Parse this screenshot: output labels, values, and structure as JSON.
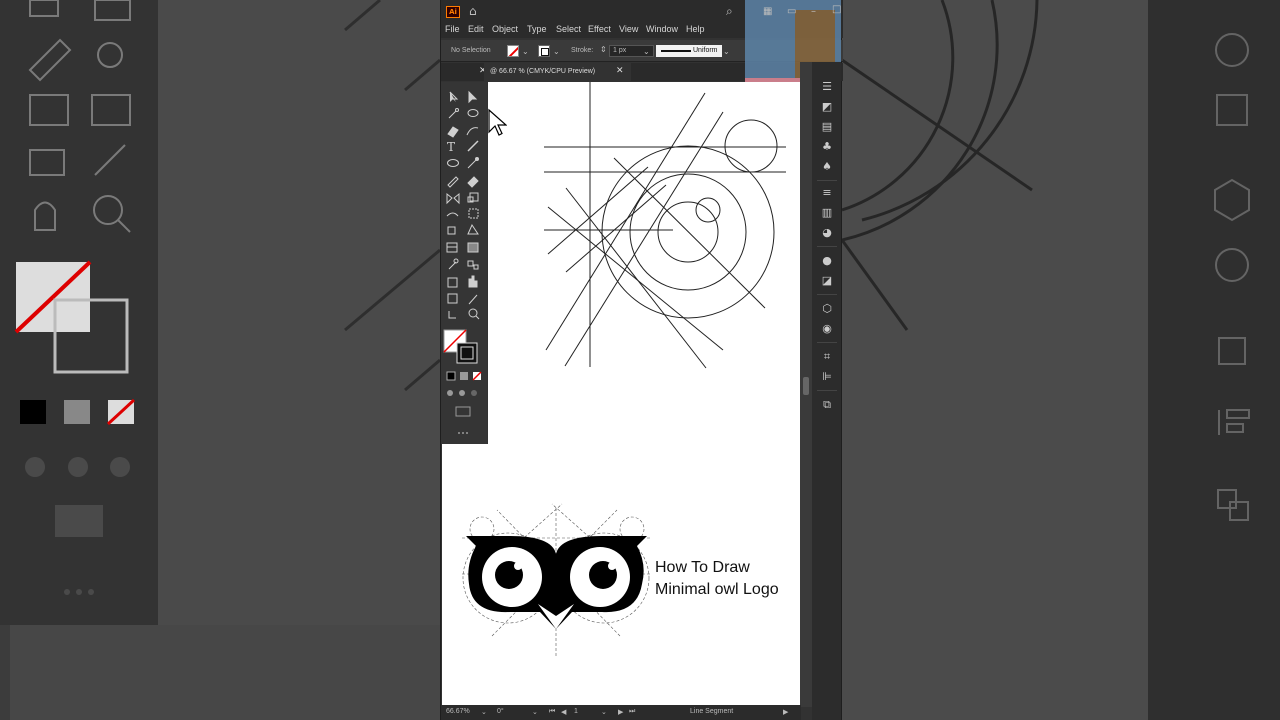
{
  "app": {
    "logo_text": "Ai",
    "menus": [
      "File",
      "Edit",
      "Object",
      "Type",
      "Select",
      "Effect",
      "View",
      "Window",
      "Help"
    ]
  },
  "control_bar": {
    "selection": "No Selection",
    "stroke_label": "Stroke:",
    "stroke_value": "1 px",
    "profile": "Uniform"
  },
  "document_tab": {
    "label": "@ 66.67 % (CMYK/CPU Preview)",
    "close": "✕"
  },
  "status_bar": {
    "zoom": "66.67%",
    "rotation": "0°",
    "artboard": "1",
    "tool_name": "Line Segment"
  },
  "promo": {
    "line1": "How To Draw",
    "line2": "Minimal owl Logo"
  },
  "tools": [
    "selection-tool",
    "direct-selection-tool",
    "magic-wand-tool",
    "lasso-tool",
    "pen-tool",
    "curvature-tool",
    "type-tool",
    "line-segment-tool",
    "ellipse-tool",
    "paintbrush-tool",
    "pencil-tool",
    "eraser-tool",
    "rotate-tool",
    "scale-tool",
    "warp-tool",
    "free-transform-tool",
    "shape-builder-tool",
    "perspective-grid-tool",
    "mesh-tool",
    "gradient-tool",
    "eyedropper-tool",
    "blend-tool",
    "symbol-sprayer-tool",
    "column-graph-tool",
    "artboard-tool",
    "slice-tool",
    "hand-tool",
    "zoom-tool"
  ],
  "colors": {
    "panel": "#323232",
    "canvas": "#ffffff",
    "accent": "#ff7c00",
    "none_swatch": "#e00000"
  }
}
